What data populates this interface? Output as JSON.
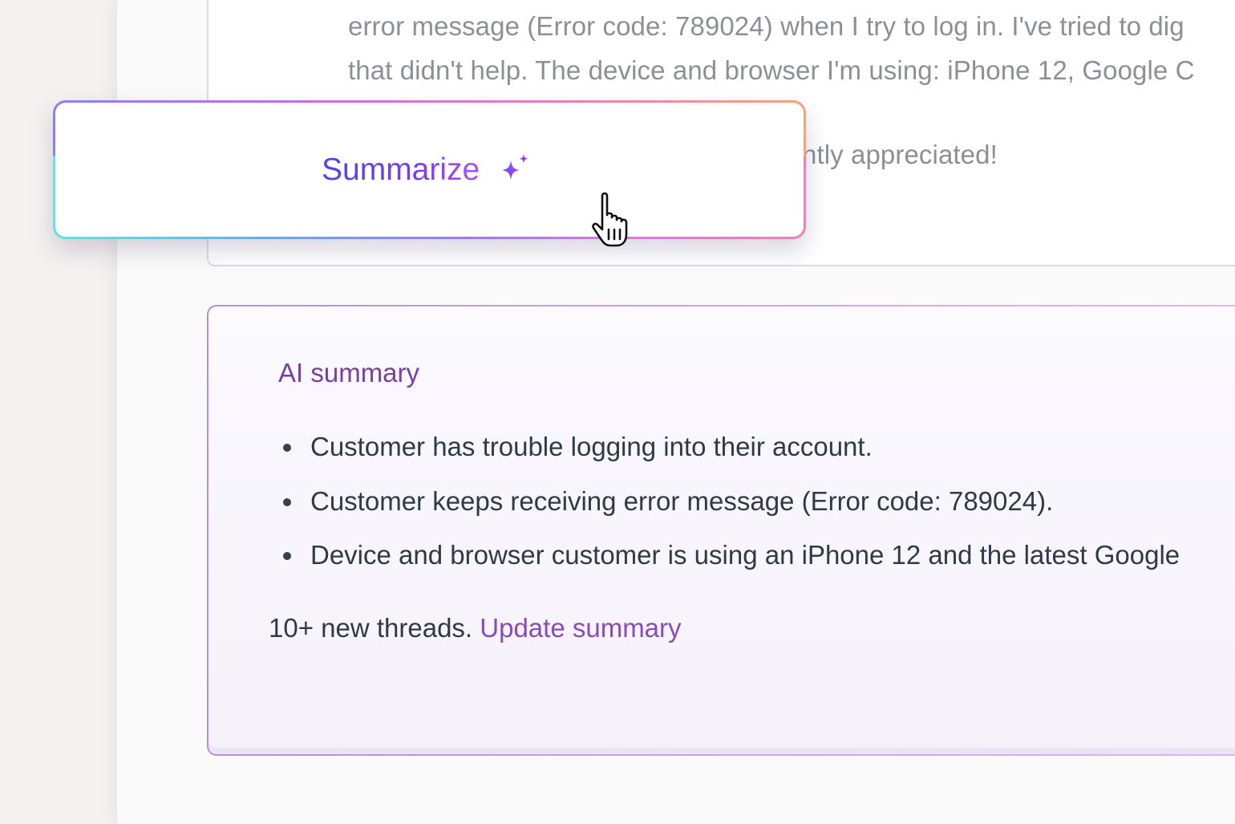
{
  "message": {
    "lines": [
      "error message (Error code: 789024) when I try to log in. I've tried to dig",
      "that didn't help. The device and browser I'm using: iPhone 12, Google C",
      "ntly appreciated!"
    ]
  },
  "summarize_button": {
    "label": "Summarize",
    "icon": "sparkle-icon",
    "accent_color": "#6d3fe6"
  },
  "ai_summary": {
    "title": "AI summary",
    "bullets": [
      "Customer has trouble logging into their account.",
      "Customer keeps receiving error message (Error code: 789024).",
      "Device and browser customer is using an iPhone 12 and the latest Google"
    ],
    "footer_text": "10+ new threads.",
    "update_link": "Update summary",
    "title_color": "#7b3fa0"
  }
}
